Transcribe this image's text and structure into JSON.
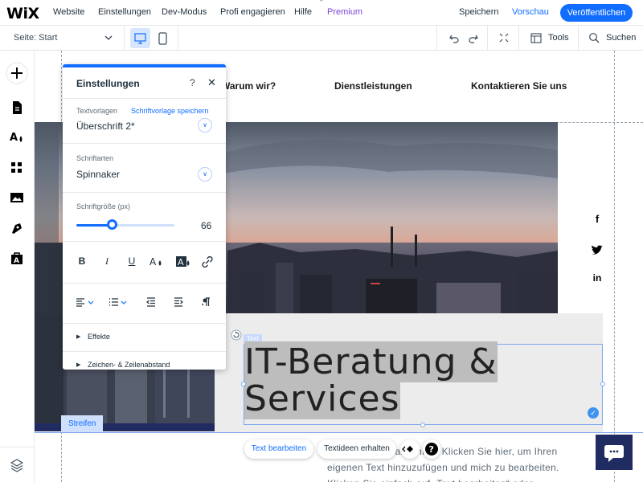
{
  "topbar": {
    "logo": "WiX",
    "nav": [
      "Website",
      "Einstellungen",
      "Dev-Modus",
      "Profi engagieren",
      "Hilfe",
      "Premium"
    ],
    "save": "Speichern",
    "preview": "Vorschau",
    "publish": "Veröffentlichen"
  },
  "secondbar": {
    "page_select": "Seite: Start",
    "tools": "Tools",
    "search": "Suchen"
  },
  "site": {
    "nav": [
      "Warum wir?",
      "Dienstleistungen",
      "Kontaktieren Sie uns"
    ],
    "text_tag": "Text",
    "heading_line1": "IT-Beratung &",
    "heading_line2": "Services",
    "strip_label": "Streifen",
    "paragraph": "Ich bin ein Textabschnitt. Klicken Sie hier, um Ihren eigenen Text hinzuzufügen und mich zu bearbeiten. Klicken Sie einfach auf „Text bearbeiten“ oder",
    "social": [
      "f",
      "t",
      "in"
    ]
  },
  "floating_actions": {
    "edit_text": "Text bearbeiten",
    "text_ideas": "Textideen erhalten"
  },
  "panel": {
    "title": "Einstellungen",
    "help": "?",
    "close": "✕",
    "themes_label": "Textvorlagen",
    "themes_link": "Schriftvorlage speichern",
    "themes_value": "Überschrift 2*",
    "fonts_label": "Schriftarten",
    "fonts_value": "Spinnaker",
    "size_label": "Schriftgröße (px)",
    "size_value": "66",
    "size_fraction": 0.36,
    "effects": "Effekte",
    "spacing": "Zeichen- & Zeilenabstand"
  },
  "colors": {
    "accent": "#116dff",
    "premium": "#7b45d6",
    "navy": "#1f2b61"
  }
}
